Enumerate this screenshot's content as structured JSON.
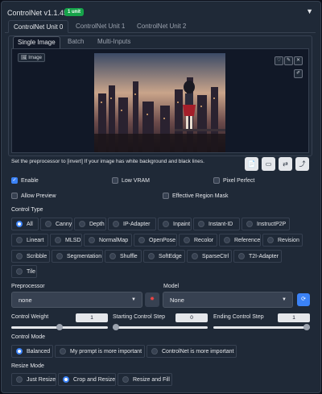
{
  "header": {
    "title": "ControlNet v1.1.455",
    "badge": "1 unit",
    "collapse_icon": "triangle-down-icon"
  },
  "unit_tabs": [
    "ControlNet Unit 0",
    "ControlNet Unit 1",
    "ControlNet Unit 2"
  ],
  "input_tabs": [
    "Single Image",
    "Batch",
    "Multi-Inputs"
  ],
  "image_panel": {
    "label": "Image"
  },
  "hint_text": "Set the preprocessor to [invert] If your image has white background and black lines.",
  "checkboxes": {
    "enable": {
      "label": "Enable",
      "checked": true
    },
    "low_vram": {
      "label": "Low VRAM",
      "checked": false
    },
    "pixel_perfect": {
      "label": "Pixel Perfect",
      "checked": false
    },
    "allow_preview": {
      "label": "Allow Preview",
      "checked": false
    },
    "effective_region_mask": {
      "label": "Effective Region Mask",
      "checked": false
    }
  },
  "control_type": {
    "label": "Control Type",
    "selected": "All",
    "options": [
      "All",
      "Canny",
      "Depth",
      "IP-Adapter",
      "Inpaint",
      "Instant-ID",
      "InstructP2P",
      "Lineart",
      "MLSD",
      "NormalMap",
      "OpenPose",
      "Recolor",
      "Reference",
      "Revision",
      "Scribble",
      "Segmentation",
      "Shuffle",
      "SoftEdge",
      "SparseCtrl",
      "T2I-Adapter",
      "Tile"
    ]
  },
  "preprocessor": {
    "label": "Preprocessor",
    "value": "none"
  },
  "model": {
    "label": "Model",
    "value": "None"
  },
  "sliders": {
    "control_weight": {
      "label": "Control Weight",
      "value": "1",
      "fraction": 0.5
    },
    "starting_step": {
      "label": "Starting Control Step",
      "value": "0",
      "fraction": 0
    },
    "ending_step": {
      "label": "Ending Control Step",
      "value": "1",
      "fraction": 1
    }
  },
  "control_mode": {
    "label": "Control Mode",
    "selected": "Balanced",
    "options": [
      "Balanced",
      "My prompt is more important",
      "ControlNet is more important"
    ]
  },
  "resize_mode": {
    "label": "Resize Mode",
    "selected": "Crop and Resize",
    "options": [
      "Just Resize",
      "Crop and Resize",
      "Resize and Fill"
    ]
  },
  "colors": {
    "accent": "#3b82f6",
    "badge": "#16a34a",
    "panel": "#1f2937",
    "background": "#0b0f19"
  }
}
